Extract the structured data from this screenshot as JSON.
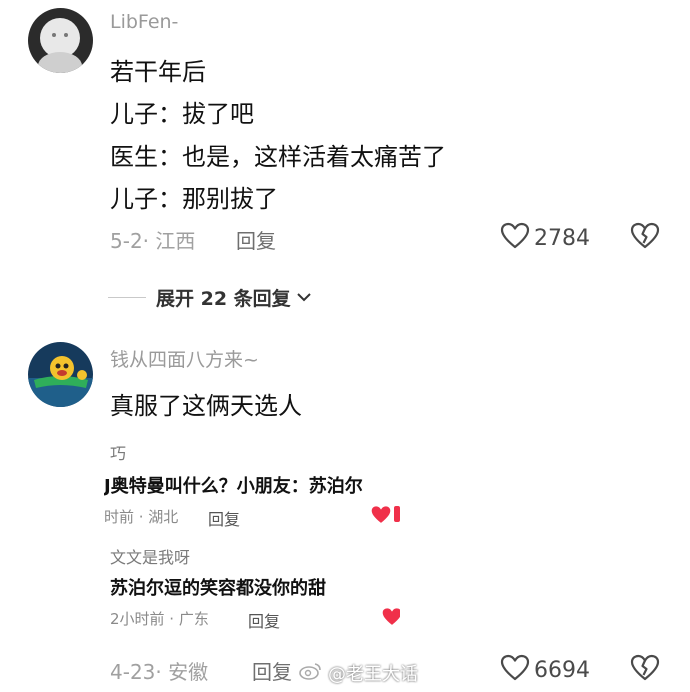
{
  "comment1": {
    "username": "LibFen-",
    "lines": [
      "若干年后",
      "儿子：拔了吧",
      "医生：也是，这样活着太痛苦了",
      "儿子：那别拔了"
    ],
    "meta": "5-2· 江西",
    "reply_label": "回复",
    "like_count": "2784",
    "expand_label": "展开 22 条回复"
  },
  "comment2": {
    "username": "钱从四面八方来~",
    "text": "真服了这俩天选人"
  },
  "embedded": {
    "reply1": {
      "username": "巧",
      "text": "J奥特曼叫什么？小朋友：苏泊尔",
      "meta": "时前 · 湖北",
      "reply_label": "回复"
    },
    "reply2": {
      "username": "文文是我呀",
      "text": "苏泊尔逗的笑容都没你的甜",
      "meta": "2小时前 · 广东",
      "reply_label": "回复"
    }
  },
  "footer": {
    "meta": "4-23· 安徽",
    "reply_label": "回复",
    "like_count": "6694"
  },
  "watermark": {
    "text": "@老王大话"
  },
  "colors": {
    "heart_red": "#f0304a",
    "accent_green": "#2fae5a"
  }
}
